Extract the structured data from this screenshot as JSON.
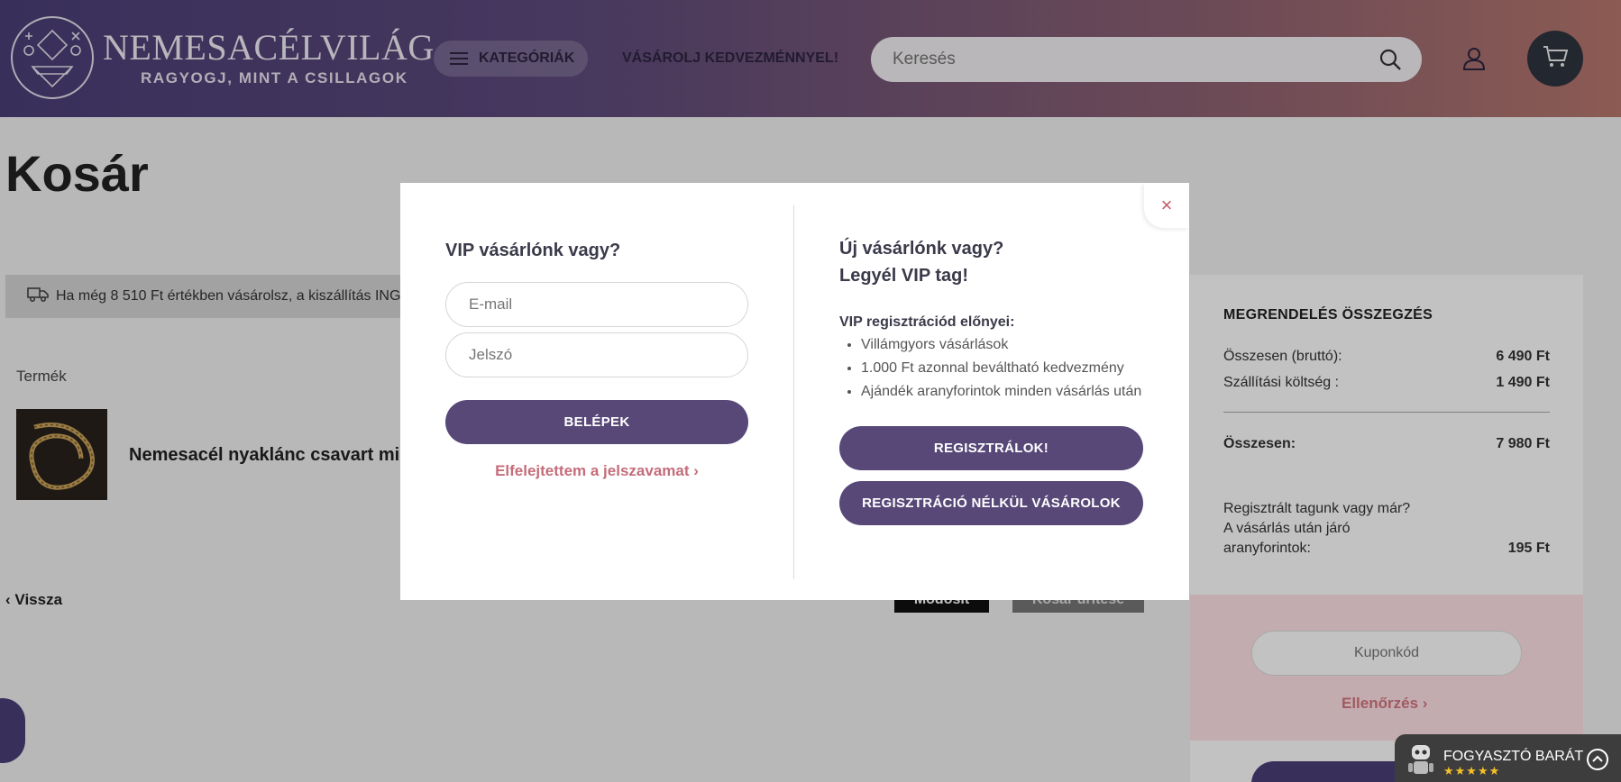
{
  "header": {
    "logo_title": "NEMESACÉLVILÁG",
    "logo_tagline": "RAGYOGJ, MINT A CSILLAGOK",
    "categories_label": "KATEGÓRIÁK",
    "promo_link": "VÁSÁROLJ KEDVEZMÉNNYEL!",
    "search_placeholder": "Keresés"
  },
  "page": {
    "title": "Kosár",
    "shipping_notice": "Ha még 8 510 Ft értékben vásárolsz, a kiszállítás INGYENES!",
    "column_product": "Termék",
    "product_name": "Nemesacél nyaklánc csavart minta",
    "back_label": "Vissza",
    "modify_label": "Módosít",
    "empty_cart_label": "Kosár ürítése"
  },
  "summary": {
    "title": "MEGRENDELÉS ÖSSZEGZÉS",
    "gross_label": "Összesen (bruttó):",
    "gross_value": "6 490 Ft",
    "shipping_label": "Szállítási költség :",
    "shipping_value": "1 490 Ft",
    "total_label": "Összesen:",
    "total_value": "7 980 Ft",
    "points_line1": "Regisztrált tagunk vagy már?",
    "points_line2": "A vásárlás után járó",
    "points_line3": "aranyforintok:",
    "points_value": "195 Ft",
    "coupon_placeholder": "Kuponkód",
    "check_label": "Ellenőrzés"
  },
  "modal": {
    "left_heading": "VIP vásárlónk vagy?",
    "email_placeholder": "E-mail",
    "password_placeholder": "Jelszó",
    "login_label": "BELÉPEK",
    "forgot_label": "Elfelejtettem a jelszavamat",
    "right_heading_line1": "Új vásárlónk vagy?",
    "right_heading_line2": "Legyél VIP tag!",
    "benefits_title": "VIP regisztrációd előnyei:",
    "benefits": [
      "Villámgyors vásárlások",
      "1.000 Ft azonnal beváltható kedvezmény",
      "Ajándék aranyforintok minden vásárlás után"
    ],
    "register_label": "REGISZTRÁLOK!",
    "no_register_label": "REGISZTRÁCIÓ NÉLKÜL VÁSÁROLOK"
  },
  "badge": {
    "text": "FOGYASZTÓ BARÁT",
    "stars": "★★★★★"
  }
}
